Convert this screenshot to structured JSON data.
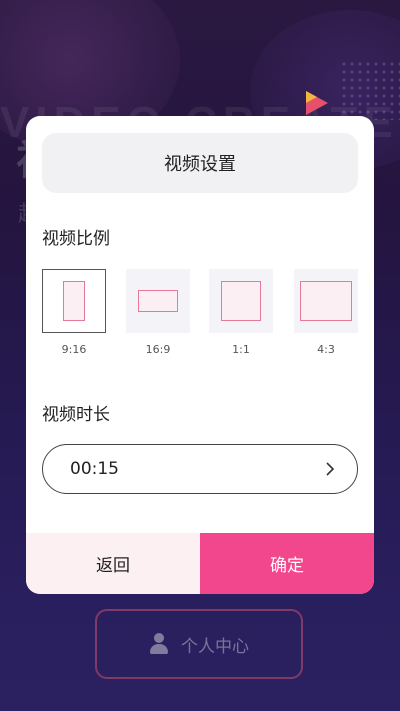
{
  "background": {
    "banner_text": "VIDEO CREATE",
    "title": "视",
    "subtitle": "超",
    "personal_center_label": "个人中心"
  },
  "modal": {
    "title": "视频设置",
    "ratio_section_label": "视频比例",
    "ratios": [
      {
        "label": "9:16",
        "selected": true
      },
      {
        "label": "16:9",
        "selected": false
      },
      {
        "label": "1:1",
        "selected": false
      },
      {
        "label": "4:3",
        "selected": false
      }
    ],
    "duration_section_label": "视频时长",
    "duration_value": "00:15",
    "back_label": "返回",
    "confirm_label": "确定"
  },
  "colors": {
    "accent": "#f2468d",
    "shape_border": "#e87a99",
    "footer_back_bg": "#fcf0f2"
  }
}
